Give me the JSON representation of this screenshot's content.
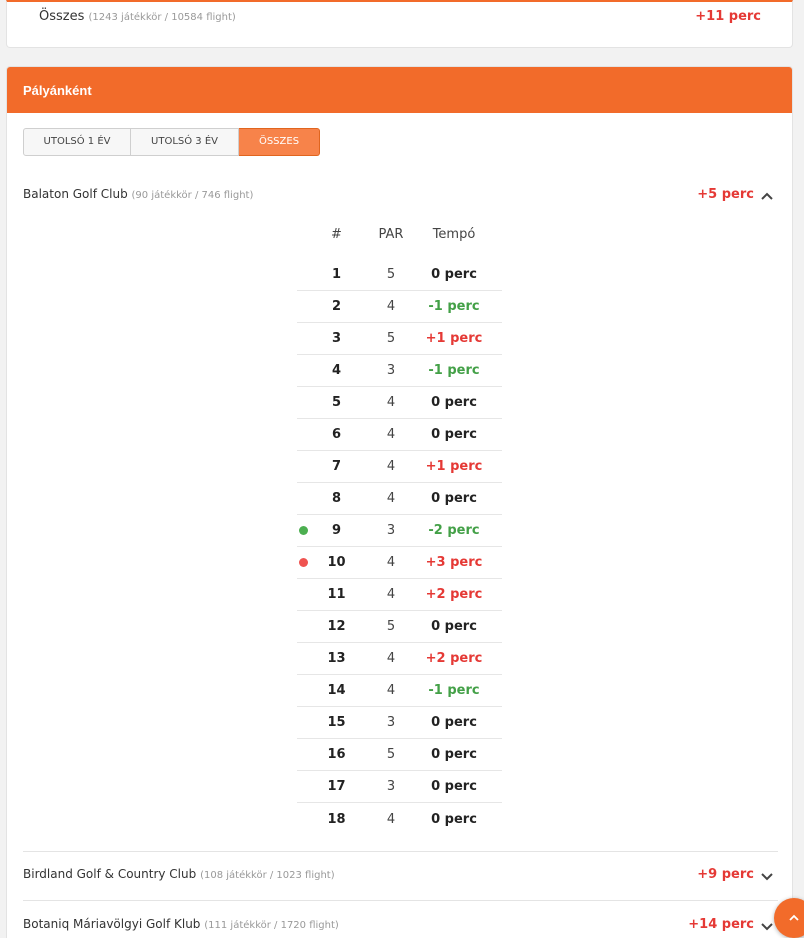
{
  "summary": {
    "label": "Összes",
    "detail": "(1243 játékkör / 10584 flight)",
    "tempo": "+11 perc"
  },
  "panel": {
    "title": "Pályánként"
  },
  "tabs": [
    {
      "label": "UTOLSÓ 1 ÉV",
      "active": false
    },
    {
      "label": "UTOLSÓ 3 ÉV",
      "active": false
    },
    {
      "label": "ÖSSZES",
      "active": true
    }
  ],
  "clubs": [
    {
      "name": "Balaton Golf Club",
      "detail": "(90 játékkör / 746 flight)",
      "tempo": "+5 perc",
      "expanded": true
    },
    {
      "name": "Birdland Golf & Country Club",
      "detail": "(108 játékkör / 1023 flight)",
      "tempo": "+9 perc",
      "expanded": false
    },
    {
      "name": "Botaniq Máriavölgyi Golf Klub",
      "detail": "(111 játékkör / 1720 flight)",
      "tempo": "+14 perc",
      "expanded": false
    }
  ],
  "holes_table": {
    "headers": {
      "num": "#",
      "par": "PAR",
      "tempo": "Tempó"
    },
    "rows": [
      {
        "num": "1",
        "par": "5",
        "tempo": "0 perc"
      },
      {
        "num": "2",
        "par": "4",
        "tempo": "-1 perc"
      },
      {
        "num": "3",
        "par": "5",
        "tempo": "+1 perc"
      },
      {
        "num": "4",
        "par": "3",
        "tempo": "-1 perc"
      },
      {
        "num": "5",
        "par": "4",
        "tempo": "0 perc"
      },
      {
        "num": "6",
        "par": "4",
        "tempo": "0 perc"
      },
      {
        "num": "7",
        "par": "4",
        "tempo": "+1 perc"
      },
      {
        "num": "8",
        "par": "4",
        "tempo": "0 perc"
      },
      {
        "num": "9",
        "par": "3",
        "tempo": "-2 perc",
        "marker": "best"
      },
      {
        "num": "10",
        "par": "4",
        "tempo": "+3 perc",
        "marker": "worst"
      },
      {
        "num": "11",
        "par": "4",
        "tempo": "+2 perc"
      },
      {
        "num": "12",
        "par": "5",
        "tempo": "0 perc"
      },
      {
        "num": "13",
        "par": "4",
        "tempo": "+2 perc"
      },
      {
        "num": "14",
        "par": "4",
        "tempo": "-1 perc"
      },
      {
        "num": "15",
        "par": "3",
        "tempo": "0 perc"
      },
      {
        "num": "16",
        "par": "5",
        "tempo": "0 perc"
      },
      {
        "num": "17",
        "par": "3",
        "tempo": "0 perc"
      },
      {
        "num": "18",
        "par": "4",
        "tempo": "0 perc"
      }
    ]
  },
  "colors": {
    "accent": "#f26b2a",
    "positive": "#e53935",
    "negative": "#43a047",
    "neutral": "#222222",
    "best_dot": "#4caf50",
    "worst_dot": "#ef5350"
  },
  "icons": {
    "expand": "chevron-up-icon",
    "collapse": "chevron-down-icon",
    "scroll_top": "arrow-up-icon"
  }
}
